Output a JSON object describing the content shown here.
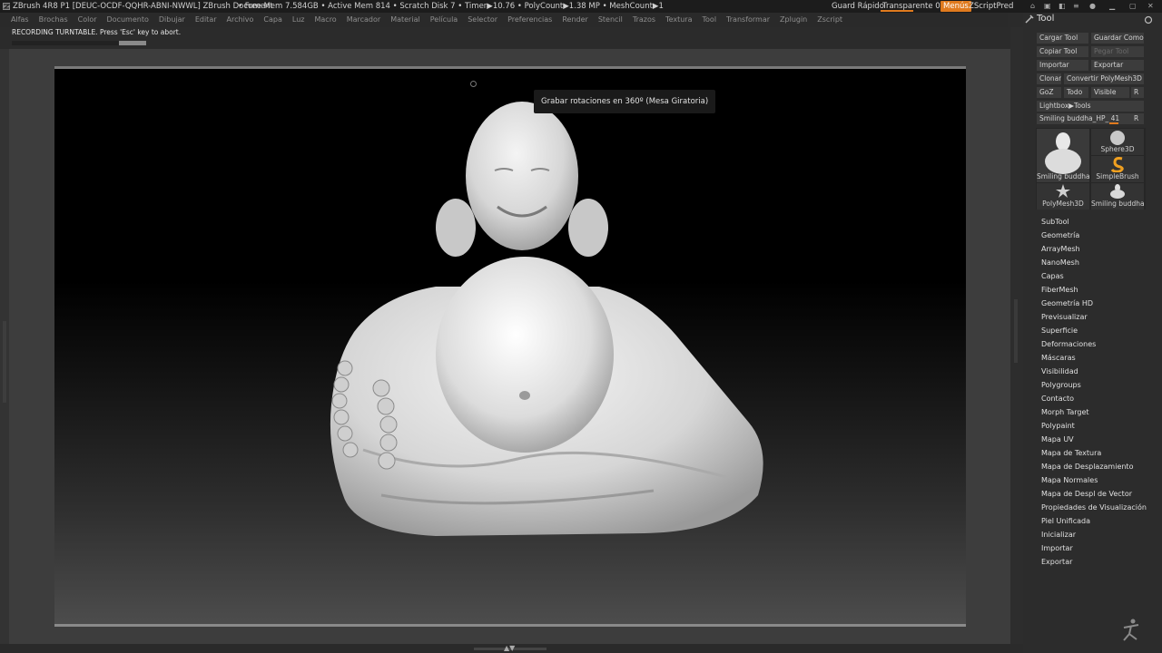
{
  "titlebar": {
    "title": "ZBrush 4R8 P1 [DEUC-OCDF-QQHR-ABNI-NWWL]   ZBrush Document",
    "stats": "• Free Mem 7.584GB • Active Mem 814 • Scratch Disk 7 •  Timer▶10.76 • PolyCount▶1.38 MP  • MeshCount▶1",
    "guard": "Guard Rápido",
    "transparent": "Transparente 0",
    "menus": "Menús",
    "zscript": "ZScriptPred"
  },
  "menubar": [
    "Alfas",
    "Brochas",
    "Color",
    "Documento",
    "Dibujar",
    "Editar",
    "Archivo",
    "Capa",
    "Luz",
    "Macro",
    "Marcador",
    "Material",
    "Película",
    "Selector",
    "Preferencias",
    "Render",
    "Stencil",
    "Trazos",
    "Textura",
    "Tool",
    "Transformar",
    "Zplugin",
    "Zscript"
  ],
  "status": {
    "recording": "RECORDING TURNTABLE. Press 'Esc' key to abort.",
    "progress": 0.8
  },
  "canvas": {
    "tooltip": "Grabar rotaciones en 360º (Mesa Giratoria)"
  },
  "panel": {
    "title": "Tool",
    "buttons": {
      "load": "Cargar Tool",
      "save_as": "Guardar Como",
      "copy": "Copiar Tool",
      "paste": "Pegar Tool",
      "import": "Importar",
      "export": "Exportar",
      "clone": "Clonar",
      "convert": "Convertir PolyMesh3D",
      "goz": "GoZ",
      "all": "Todo",
      "visible": "Visible",
      "r": "R",
      "lightbox": "Lightbox▶Tools"
    },
    "slider": {
      "label": "Smiling buddha_HP_ 41",
      "r": "R"
    },
    "thumbs": {
      "t1": "Smiling buddha_",
      "t2": "Sphere3D",
      "t3": "SimpleBrush",
      "t4": "PolyMesh3D",
      "t5": "Smiling buddha_"
    },
    "submenus": [
      "SubTool",
      "Geometría",
      "ArrayMesh",
      "NanoMesh",
      "Capas",
      "FiberMesh",
      "Geometría HD",
      "Previsualizar",
      "Superficie",
      "Deformaciones",
      "Máscaras",
      "Visibilidad",
      "Polygroups",
      "Contacto",
      "Morph Target",
      "Polypaint",
      "Mapa UV",
      "Mapa de Textura",
      "Mapa de Desplazamiento",
      "Mapa Normales",
      "Mapa de Despl de Vector",
      "Propiedades de Visualización",
      "Piel Unificada",
      "Inicializar",
      "Importar",
      "Exportar"
    ]
  },
  "colors": {
    "accent": "#e07a1e",
    "background": "#2b2b2b",
    "canvas": "#000000"
  },
  "icons": [
    "zbrush-logo-icon",
    "home-icon",
    "refresh-icon",
    "tool-brush-icon",
    "sphere3d-icon",
    "simplebrush-icon",
    "polymesh3d-icon",
    "zbrush-figure-logo-icon"
  ]
}
